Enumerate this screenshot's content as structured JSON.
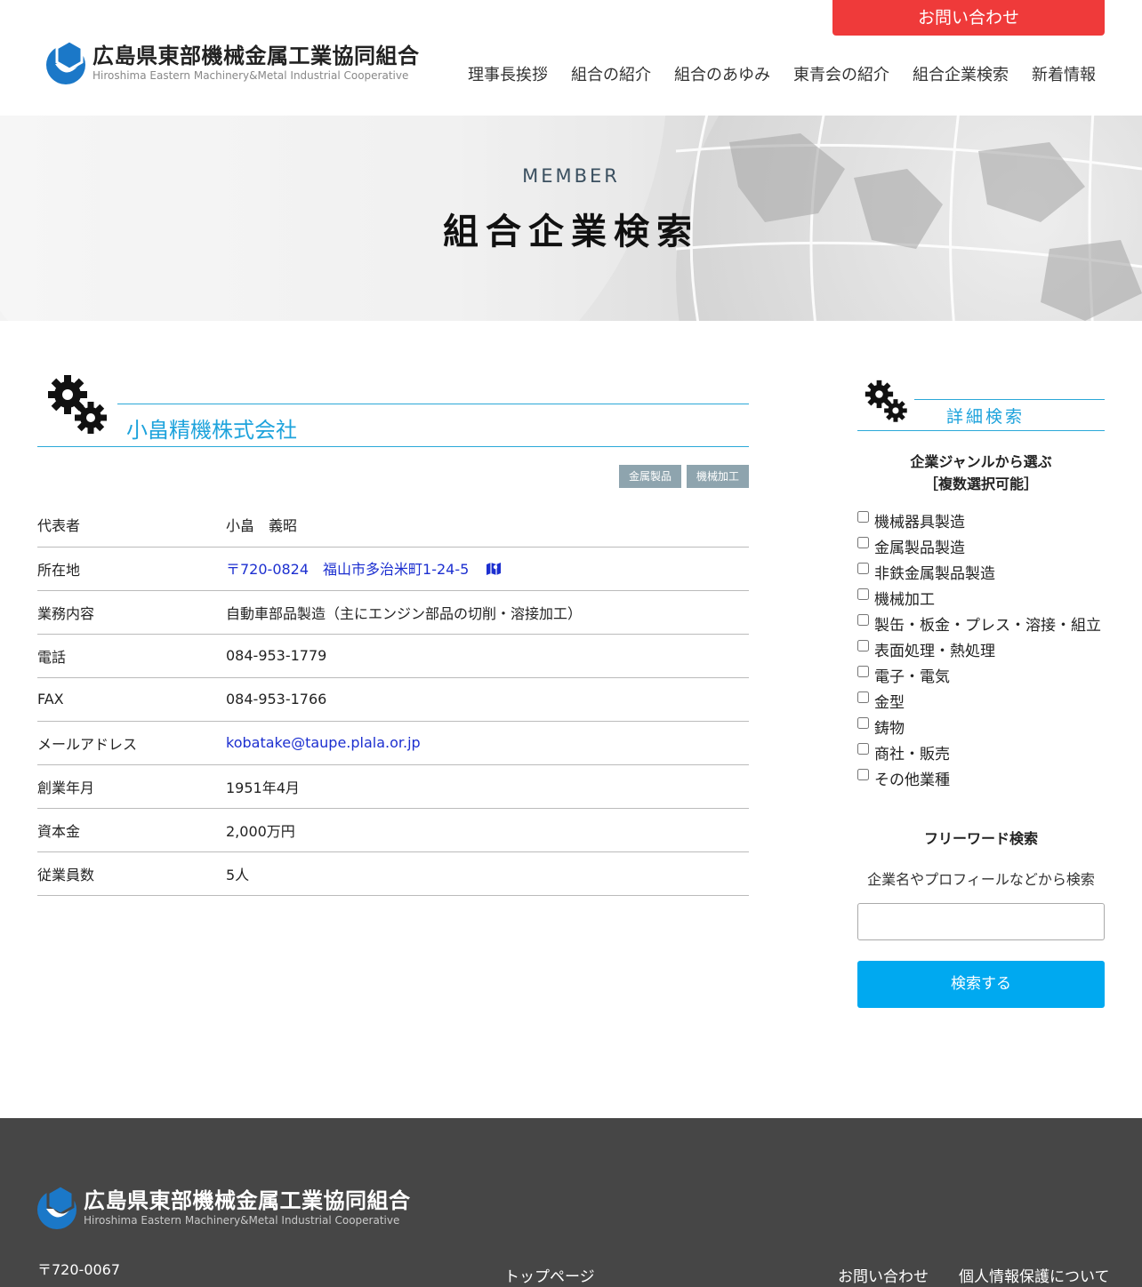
{
  "header": {
    "contact_label": "お問い合わせ",
    "logo_jp": "広島県東部機械金属工業協同組合",
    "logo_en": "Hiroshima Eastern Machinery&Metal Industrial Cooperative",
    "nav": [
      "理事長挨拶",
      "組合の紹介",
      "組合のあゆみ",
      "東青会の紹介",
      "組合企業検索",
      "新着情報"
    ]
  },
  "hero": {
    "subtitle": "MEMBER",
    "title": "組合企業検索"
  },
  "company": {
    "name": "小畠精機株式会社",
    "tags": [
      "金属製品",
      "機械加工"
    ],
    "rows": [
      {
        "key": "代表者",
        "value": "小畠　義昭"
      },
      {
        "key": "所在地",
        "value": "〒720-0824　福山市多治米町1-24-5"
      },
      {
        "key": "業務内容",
        "value": "自動車部品製造（主にエンジン部品の切削・溶接加工）"
      },
      {
        "key": "電話",
        "value": "084-953-1779"
      },
      {
        "key": "FAX",
        "value": "084-953-1766"
      },
      {
        "key": "メールアドレス",
        "value": "kobatake@taupe.plala.or.jp"
      },
      {
        "key": "創業年月",
        "value": "1951年4月"
      },
      {
        "key": "資本金",
        "value": "2,000万円"
      },
      {
        "key": "従業員数",
        "value": "5人"
      }
    ]
  },
  "sidebar": {
    "title": "詳細検索",
    "genre_title_1": "企業ジャンルから選ぶ",
    "genre_title_2": "［複数選択可能］",
    "genres": [
      "機械器具製造",
      "金属製品製造",
      "非鉄金属製品製造",
      "機械加工",
      "製缶・板金・プレス・溶接・組立",
      "表面処理・熱処理",
      "電子・電気",
      "金型",
      "鋳物",
      "商社・販売",
      "その他業種"
    ],
    "free_title": "フリーワード検索",
    "free_desc": "企業名やプロフィールなどから検索",
    "search_label": "検索する"
  },
  "footer": {
    "logo_jp": "広島県東部機械金属工業協同組合",
    "logo_en": "Hiroshima Eastern Machinery&Metal Industrial Cooperative",
    "postal": "〒720-0067",
    "nav_top": "トップページ",
    "nav_contact": "お問い合わせ",
    "nav_privacy": "個人情報保護について"
  },
  "colors": {
    "accent": "#1ea3dc",
    "contact_button": "#ef3a3a",
    "search_button": "#00a9f0",
    "footer_bg": "#464646",
    "tag_bg": "#8ea4ae",
    "link": "#1c2fd0"
  },
  "icons": [
    "logo-mark-icon",
    "gear-icon",
    "map-icon"
  ]
}
